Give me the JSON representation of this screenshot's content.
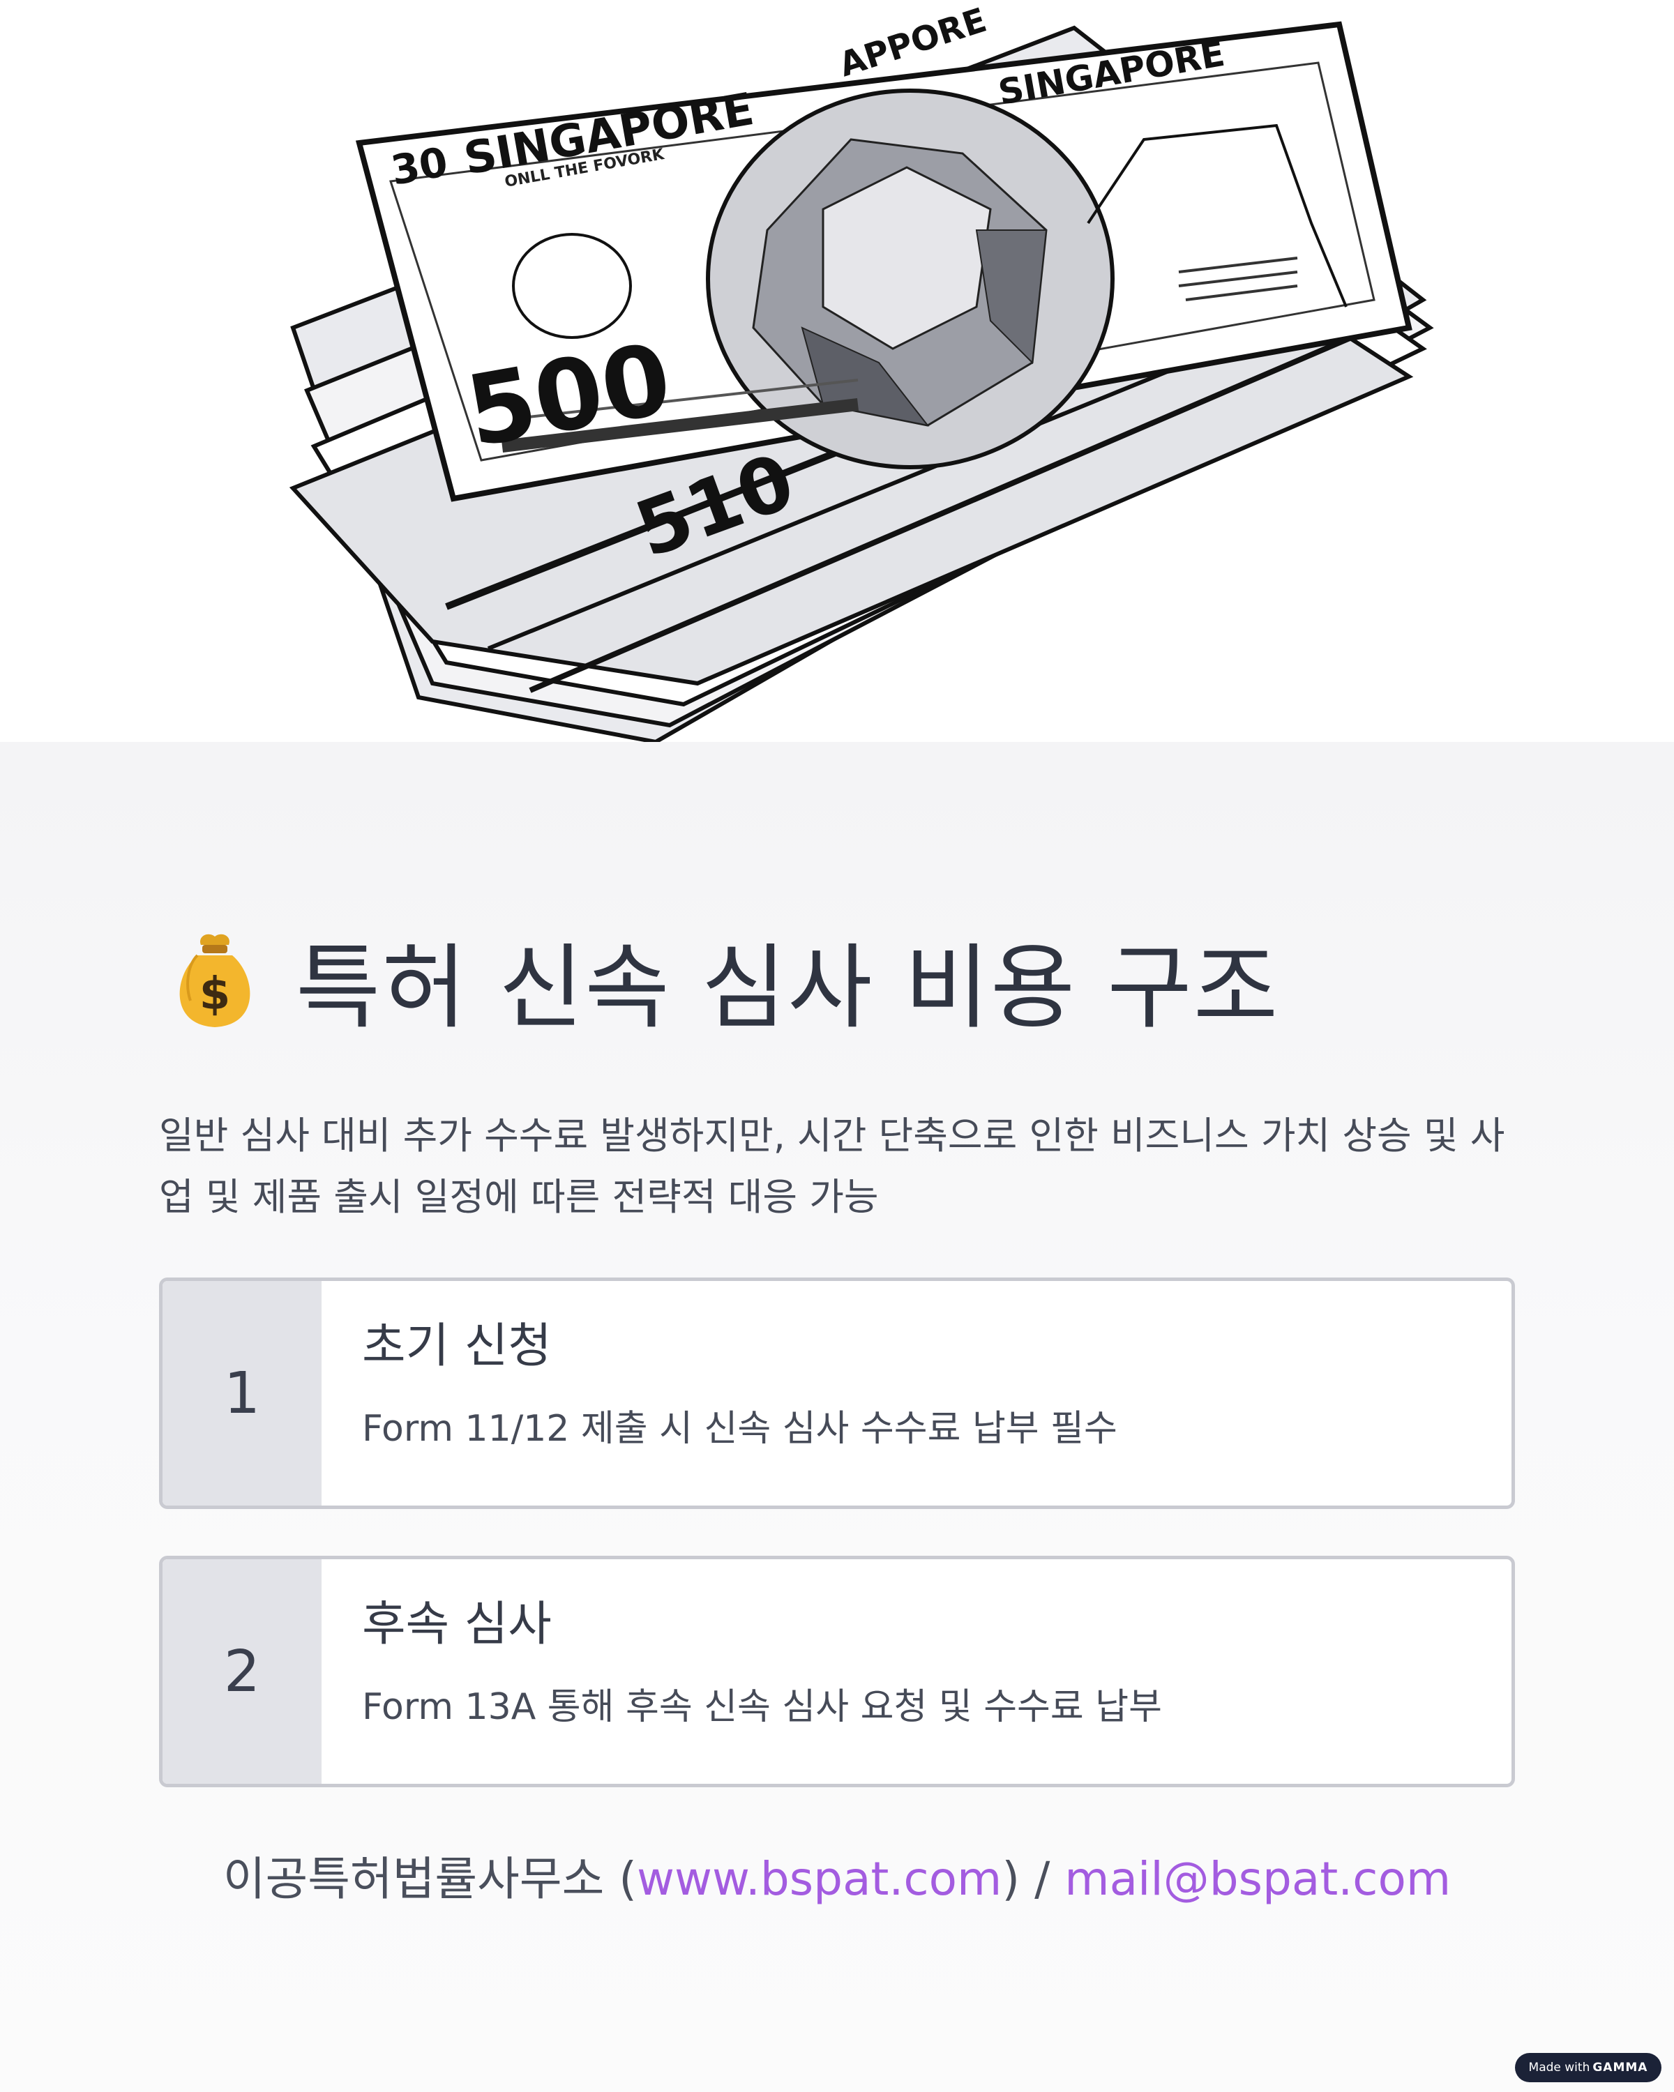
{
  "hero": {
    "bill_country": "SINGAPORE",
    "bill_top_prefix": "30",
    "bill_subtitle": "ONLL THE FOVORK",
    "bill_value": "500",
    "bill_back_value": "510",
    "bill_back_text": "APPORE"
  },
  "title": {
    "icon": "money-bag-icon",
    "text": "특허 신속 심사 비용 구조"
  },
  "intro": "일반 심사 대비 추가 수수료 발생하지만, 시간 단축으로 인한 비즈니스 가치 상승 및 사업 및 제품 출시 일정에 따른 전략적 대응 가능",
  "steps": [
    {
      "number": "1",
      "title": "초기 신청",
      "description": "Form 11/12 제출 시 신속 심사 수수료 납부 필수"
    },
    {
      "number": "2",
      "title": "후속 심사",
      "description": "Form 13A 통해 후속 신속 심사 요청 및 수수료 납부"
    }
  ],
  "footer": {
    "firm": "이공특허법률사무소 (",
    "website": "www.bspat.com",
    "separator": ") / ",
    "email": "mail@bspat.com"
  },
  "badge": {
    "prefix": "Made with",
    "brand": "GAMMA"
  },
  "colors": {
    "link": "#a35ce0",
    "step_number_bg": "#e2e3e8",
    "card_border": "#c9cad1",
    "badge_bg": "#1b2237"
  }
}
